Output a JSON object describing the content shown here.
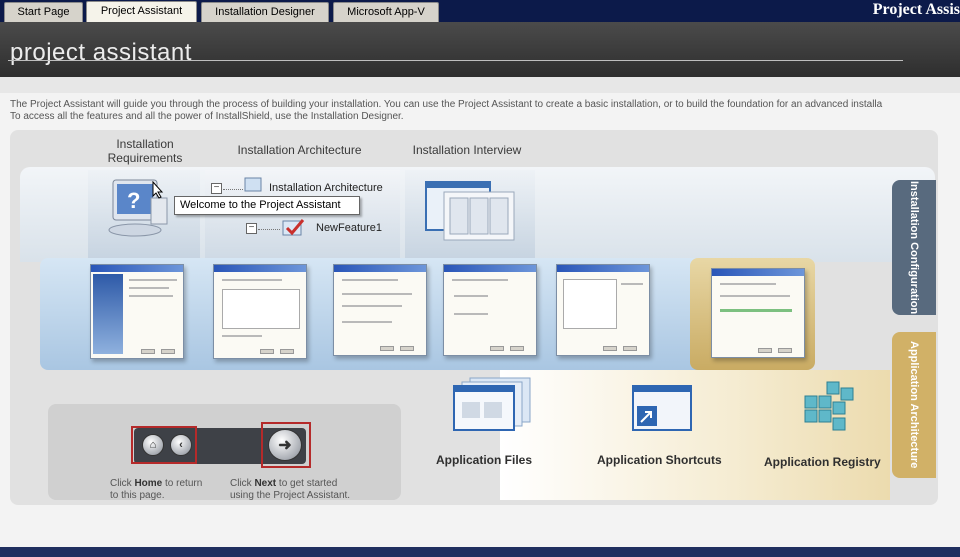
{
  "tabs": [
    "Start Page",
    "Project Assistant",
    "Installation Designer",
    "Microsoft App-V"
  ],
  "active_tab": 1,
  "brand": "Project Assis",
  "header": {
    "title": "project assistant"
  },
  "intro": {
    "line1": "The Project Assistant will guide you through the process of building your installation. You can use the Project Assistant to create a basic installation, or to build the foundation for an advanced installa",
    "line2": "To access all the features and all the power of InstallShield, use the Installation Designer."
  },
  "columns": {
    "requirements_1": "Installation",
    "requirements_2": "Requirements",
    "architecture": "Installation Architecture",
    "interview": "Installation Interview"
  },
  "tree": {
    "node1": "Installation Architecture",
    "node2": "NewFeature1"
  },
  "tooltip": "Welcome to the Project Assistant",
  "side_tabs": {
    "config": "Installation Configuration",
    "app": "Application Architecture"
  },
  "nav": {
    "home_hint_1": "Click",
    "home_hint_bold": "Home",
    "home_hint_2": "to return",
    "home_hint_3": "to this page.",
    "next_hint_1": "Click",
    "next_hint_bold": "Next",
    "next_hint_2": "to get started",
    "next_hint_3": "using the Project Assistant."
  },
  "app_items": [
    "Application Files",
    "Application Shortcuts",
    "Application Registry"
  ],
  "colors": {
    "tabbar": "#0c1a4a",
    "config_tab": "#586a7e",
    "app_tab": "#d1b167",
    "frame_red": "#b52a2a"
  }
}
